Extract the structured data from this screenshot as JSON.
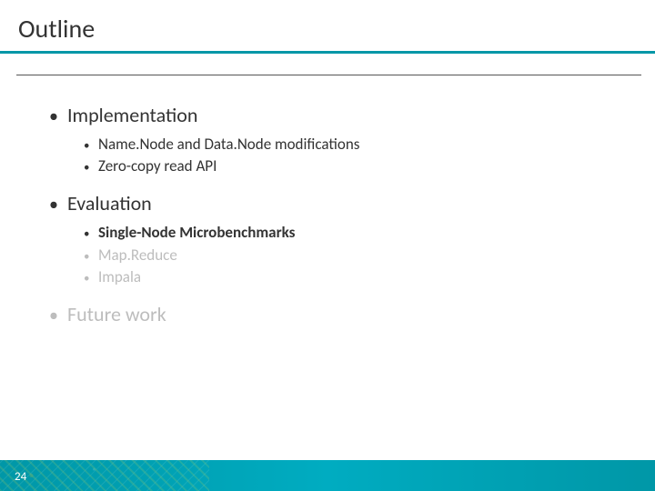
{
  "title": "Outline",
  "sections": [
    {
      "label": "Implementation",
      "dim": false,
      "items": [
        {
          "label": "Name.Node and Data.Node modifications",
          "dim": false,
          "bold": false
        },
        {
          "label": "Zero-copy read API",
          "dim": false,
          "bold": false
        }
      ]
    },
    {
      "label": "Evaluation",
      "dim": false,
      "items": [
        {
          "label": "Single-Node Microbenchmarks",
          "dim": false,
          "bold": true
        },
        {
          "label": "Map.Reduce",
          "dim": true,
          "bold": false
        },
        {
          "label": "Impala",
          "dim": true,
          "bold": false
        }
      ]
    },
    {
      "label": "Future work",
      "dim": true,
      "items": []
    }
  ],
  "page_number": "24"
}
